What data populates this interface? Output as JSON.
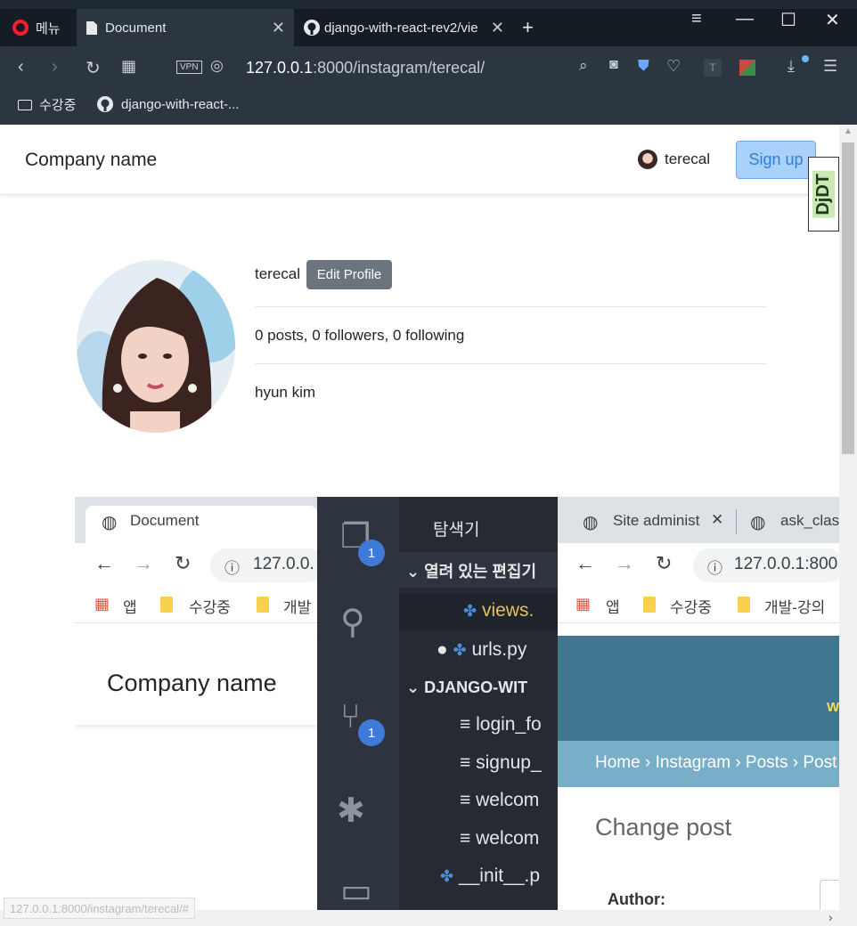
{
  "browser": {
    "tabs": [
      {
        "label": "메뉴"
      },
      {
        "label": "Document"
      },
      {
        "label": "django-with-react-rev2/vie"
      }
    ],
    "vpn_label": "VPN",
    "url_host": "127.0.0.1",
    "url_rest": ":8000/instagram/terecal/",
    "bookmarks": [
      {
        "label": "수강중"
      },
      {
        "label": "django-with-react-..."
      }
    ],
    "status_url": "127.0.0.1:8000/instagram/terecal/#"
  },
  "navbar": {
    "brand": "Company name",
    "username": "terecal",
    "signup_label": "Sign up",
    "djdt_label": "DjDT"
  },
  "profile": {
    "username": "terecal",
    "edit_label": "Edit Profile",
    "stats": "0 posts, 0 followers, 0 following",
    "full_name": "hyun kim"
  },
  "collage": {
    "left": {
      "tab_title": "Document",
      "url": "127.0.0.",
      "bookmarks": [
        "앱",
        "수강중",
        "개발"
      ],
      "brand": "Company name"
    },
    "editor": {
      "explorer_title": "탐색기",
      "open_editors": "열려 있는 편집기",
      "files": [
        "views.",
        "urls.py"
      ],
      "project": "DJANGO-WIT",
      "tree": [
        "login_fo",
        "signup_",
        "welcom",
        "welcom",
        "__init__.p"
      ],
      "badge1": "1",
      "badge2": "1"
    },
    "right": {
      "tabs": [
        "Site administ",
        "ask_class"
      ],
      "url": "127.0.0.1:800",
      "bookmarks": [
        "앱",
        "수강중",
        "개발-강의"
      ],
      "header_letter": "W",
      "breadcrumb": "Home › Instagram › Posts › Post",
      "heading": "Change post",
      "field_label": "Author:"
    }
  }
}
